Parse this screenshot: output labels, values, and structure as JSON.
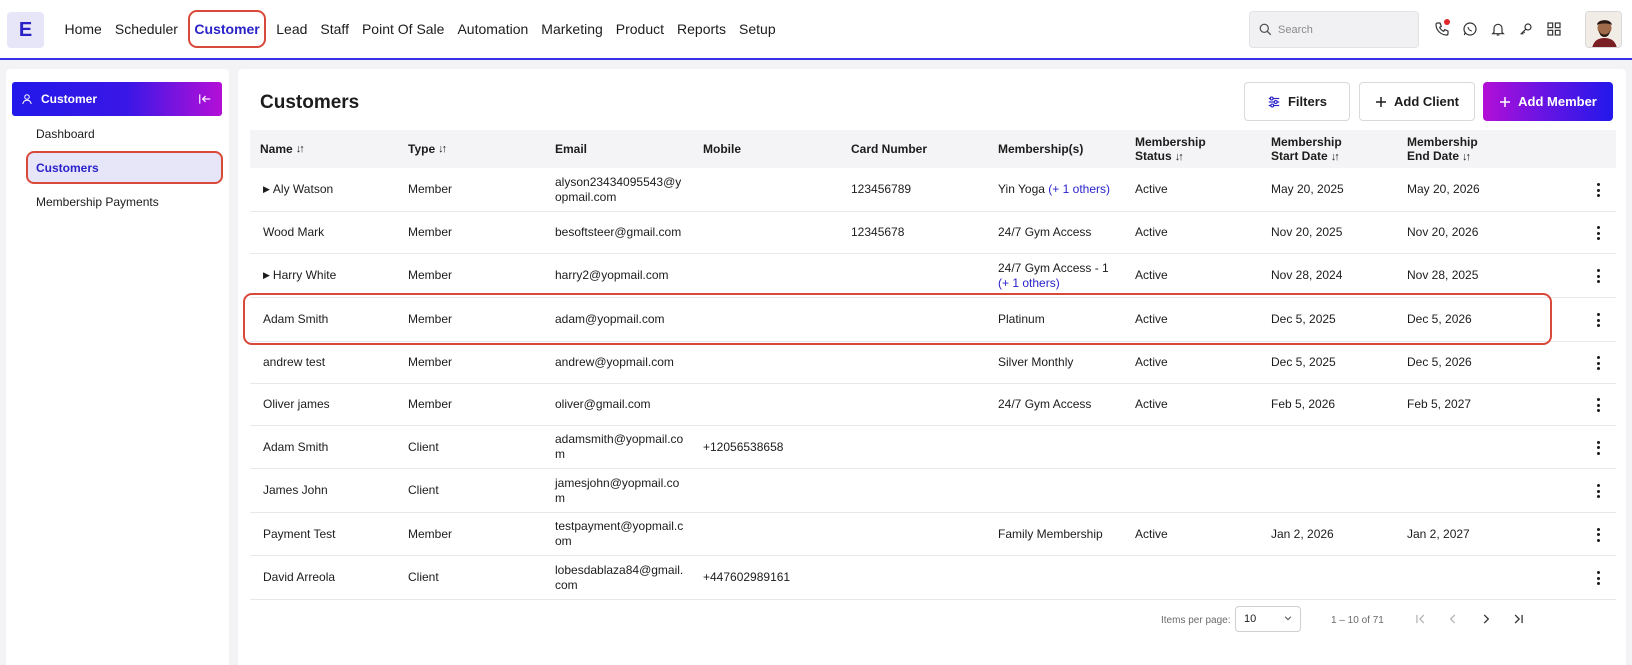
{
  "app": {
    "logo_letter": "E"
  },
  "nav": [
    "Home",
    "Scheduler",
    "Customer",
    "Lead",
    "Staff",
    "Point Of Sale",
    "Automation",
    "Marketing",
    "Product",
    "Reports",
    "Setup"
  ],
  "search": {
    "placeholder": "Search",
    "value": ""
  },
  "sidebar": {
    "header": "Customer",
    "items": [
      "Dashboard",
      "Customers",
      "Membership Payments"
    ],
    "active": "Customers"
  },
  "main": {
    "title": "Customers",
    "buttons": {
      "filters": "Filters",
      "add_client": "Add Client",
      "add_member": "Add Member"
    }
  },
  "table": {
    "headers": {
      "name": "Name",
      "type": "Type",
      "email": "Email",
      "mobile": "Mobile",
      "card": "Card Number",
      "memberships": "Membership(s)",
      "status_1": "Membership",
      "status_2": "Status",
      "start_1": "Membership",
      "start_2": "Start Date",
      "end_1": "Membership",
      "end_2": "End Date"
    },
    "rows": [
      {
        "name": "Aly Watson",
        "expandable": true,
        "type": "Member",
        "email": "alyson23434095543@yopmail.com",
        "mobile": "",
        "card": "123456789",
        "membership": "Yin Yoga",
        "membership_extra": "(+ 1 others)",
        "status": "Active",
        "start": "May 20, 2025",
        "end": "May 20, 2026"
      },
      {
        "name": "Wood Mark",
        "expandable": false,
        "type": "Member",
        "email": "besoftsteer@gmail.com",
        "mobile": "",
        "card": "12345678",
        "membership": "24/7 Gym Access",
        "membership_extra": "",
        "status": "Active",
        "start": "Nov 20, 2025",
        "end": "Nov 20, 2026"
      },
      {
        "name": "Harry White",
        "expandable": true,
        "type": "Member",
        "email": "harry2@yopmail.com",
        "mobile": "",
        "card": "",
        "membership": "24/7 Gym Access - 1",
        "membership_extra": "(+ 1 others)",
        "status": "Active",
        "start": "Nov 28, 2024",
        "end": "Nov 28, 2025"
      },
      {
        "name": "Adam Smith",
        "expandable": false,
        "type": "Member",
        "email": "adam@yopmail.com",
        "mobile": "",
        "card": "",
        "membership": "Platinum",
        "membership_extra": "",
        "status": "Active",
        "start": "Dec 5, 2025",
        "end": "Dec 5, 2026"
      },
      {
        "name": "andrew test",
        "expandable": false,
        "type": "Member",
        "email": "andrew@yopmail.com",
        "mobile": "",
        "card": "",
        "membership": "Silver Monthly",
        "membership_extra": "",
        "status": "Active",
        "start": "Dec 5, 2025",
        "end": "Dec 5, 2026"
      },
      {
        "name": "Oliver james",
        "expandable": false,
        "type": "Member",
        "email": "oliver@gmail.com",
        "mobile": "",
        "card": "",
        "membership": "24/7 Gym Access",
        "membership_extra": "",
        "status": "Active",
        "start": "Feb 5, 2026",
        "end": "Feb 5, 2027"
      },
      {
        "name": "Adam Smith",
        "expandable": false,
        "type": "Client",
        "email": "adamsmith@yopmail.com",
        "mobile": "+12056538658",
        "card": "",
        "membership": "",
        "membership_extra": "",
        "status": "",
        "start": "",
        "end": ""
      },
      {
        "name": "James John",
        "expandable": false,
        "type": "Client",
        "email": "jamesjohn@yopmail.com",
        "mobile": "",
        "card": "",
        "membership": "",
        "membership_extra": "",
        "status": "",
        "start": "",
        "end": ""
      },
      {
        "name": "Payment Test",
        "expandable": false,
        "type": "Member",
        "email": "testpayment@yopmail.com",
        "mobile": "",
        "card": "",
        "membership": "Family Membership",
        "membership_extra": "",
        "status": "Active",
        "start": "Jan 2, 2026",
        "end": "Jan 2, 2027"
      },
      {
        "name": "David Arreola",
        "expandable": false,
        "type": "Client",
        "email": "lobesdablaza84@gmail.com",
        "mobile": "+447602989161",
        "card": "",
        "membership": "",
        "membership_extra": "",
        "status": "",
        "start": "",
        "end": ""
      }
    ]
  },
  "pagination": {
    "label": "Items per page:",
    "per_page": "10",
    "range": "1 – 10 of 71"
  },
  "colors": {
    "accent": "#2a22c8",
    "highlight": "#d9493a",
    "gradient_start": "#b30fd6",
    "gradient_end": "#2218ea"
  }
}
